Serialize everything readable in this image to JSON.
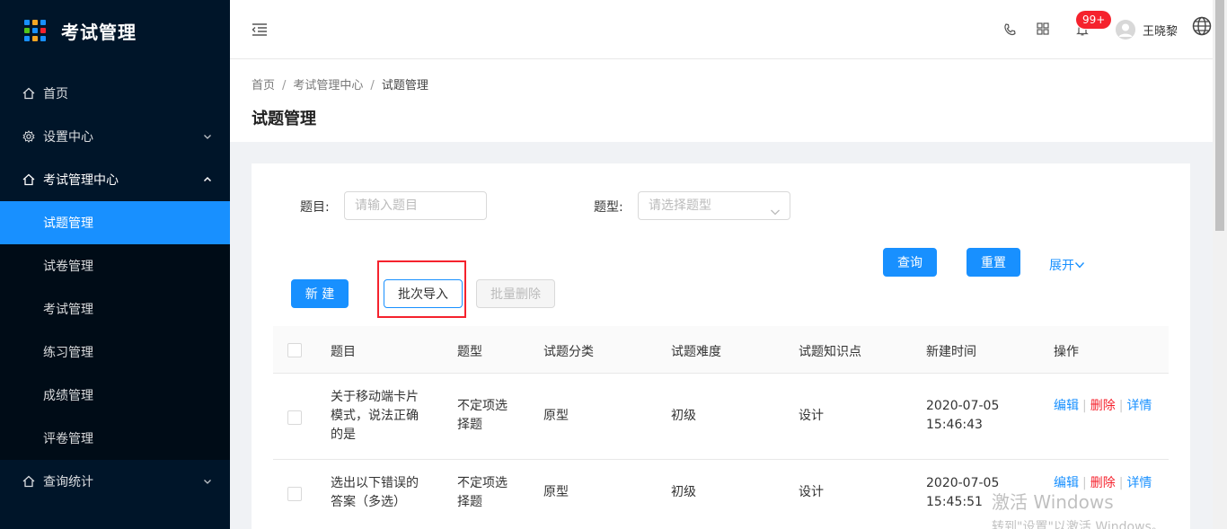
{
  "app": {
    "title": "考试管理"
  },
  "sidebar": {
    "items": [
      {
        "label": "首页",
        "icon": "home-icon"
      },
      {
        "label": "设置中心",
        "icon": "gear-icon"
      },
      {
        "label": "考试管理中心",
        "icon": "home-icon"
      },
      {
        "label": "查询统计",
        "icon": "home-icon"
      }
    ],
    "submenu": [
      "试题管理",
      "试卷管理",
      "考试管理",
      "练习管理",
      "成绩管理",
      "评卷管理"
    ]
  },
  "header": {
    "notification_count": "99+",
    "user_name": "王晓黎"
  },
  "breadcrumb": [
    "首页",
    "考试管理中心",
    "试题管理"
  ],
  "page_title": "试题管理",
  "filters": {
    "question_label": "题目:",
    "question_placeholder": "请输入题目",
    "type_label": "题型:",
    "type_placeholder": "请选择题型"
  },
  "actions": {
    "query": "查询",
    "reset": "重置",
    "expand": "展开",
    "new": "新 建",
    "batch_import": "批次导入",
    "batch_delete": "批量删除"
  },
  "table": {
    "headers": [
      "题目",
      "题型",
      "试题分类",
      "试题难度",
      "试题知识点",
      "新建时间",
      "操作"
    ],
    "ops": {
      "edit": "编辑",
      "delete": "删除",
      "detail": "详情"
    },
    "rows": [
      {
        "question": [
          "关于移动端卡片",
          "模式，说法正确",
          "的是"
        ],
        "type": [
          "不定项选",
          "择题"
        ],
        "category": "原型",
        "difficulty": "初级",
        "knowledge": "设计",
        "date": "2020-07-05",
        "time": "15:46:43"
      },
      {
        "question": [
          "选出以下错误的",
          "答案（多选）"
        ],
        "type": [
          "不定项选",
          "择题"
        ],
        "category": "原型",
        "difficulty": "初级",
        "knowledge": "设计",
        "date": "2020-07-05",
        "time": "15:45:51"
      }
    ]
  },
  "watermark": {
    "line1": "激活 Windows",
    "line2": "转到\"设置\"以激活 Windows。"
  }
}
